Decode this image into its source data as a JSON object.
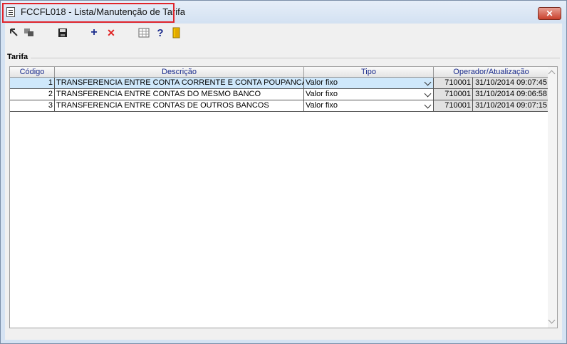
{
  "window": {
    "title": "FCCFL018 - Lista/Manutenção de Tarifa",
    "close_label": "✕"
  },
  "toolbar": {
    "buttons": [
      {
        "name": "navigate-icon"
      },
      {
        "name": "copy-icon"
      },
      {
        "name": "save-icon"
      },
      {
        "name": "add-icon",
        "glyph": "+"
      },
      {
        "name": "delete-icon",
        "glyph": "✕"
      },
      {
        "name": "table-view-icon"
      },
      {
        "name": "help-icon",
        "glyph": "?"
      },
      {
        "name": "exit-icon"
      }
    ]
  },
  "group": {
    "label": "Tarifa"
  },
  "table": {
    "columns": [
      "Código",
      "Descrição",
      "Tipo",
      "Operador/Atualização"
    ],
    "rows": [
      {
        "codigo": "1",
        "descricao": "TRANSFERENCIA ENTRE CONTA CORRENTE E CONTA POUPANCA",
        "tipo": "Valor fixo",
        "operador": "710001",
        "data": "31/10/2014 09:07:45"
      },
      {
        "codigo": "2",
        "descricao": "TRANSFERENCIA ENTRE CONTAS DO MESMO BANCO",
        "tipo": "Valor fixo",
        "operador": "710001",
        "data": "31/10/2014 09:06:58"
      },
      {
        "codigo": "3",
        "descricao": "TRANSFERENCIA ENTRE CONTAS DE OUTROS BANCOS",
        "tipo": "Valor fixo",
        "operador": "710001",
        "data": "31/10/2014 09:07:15"
      }
    ]
  },
  "colors": {
    "highlight_border": "#e0242a",
    "selected_row": "#cfe8fb",
    "header_text": "#1a2b8c",
    "delete_icon": "#e02020",
    "add_icon": "#1a2b8c"
  }
}
